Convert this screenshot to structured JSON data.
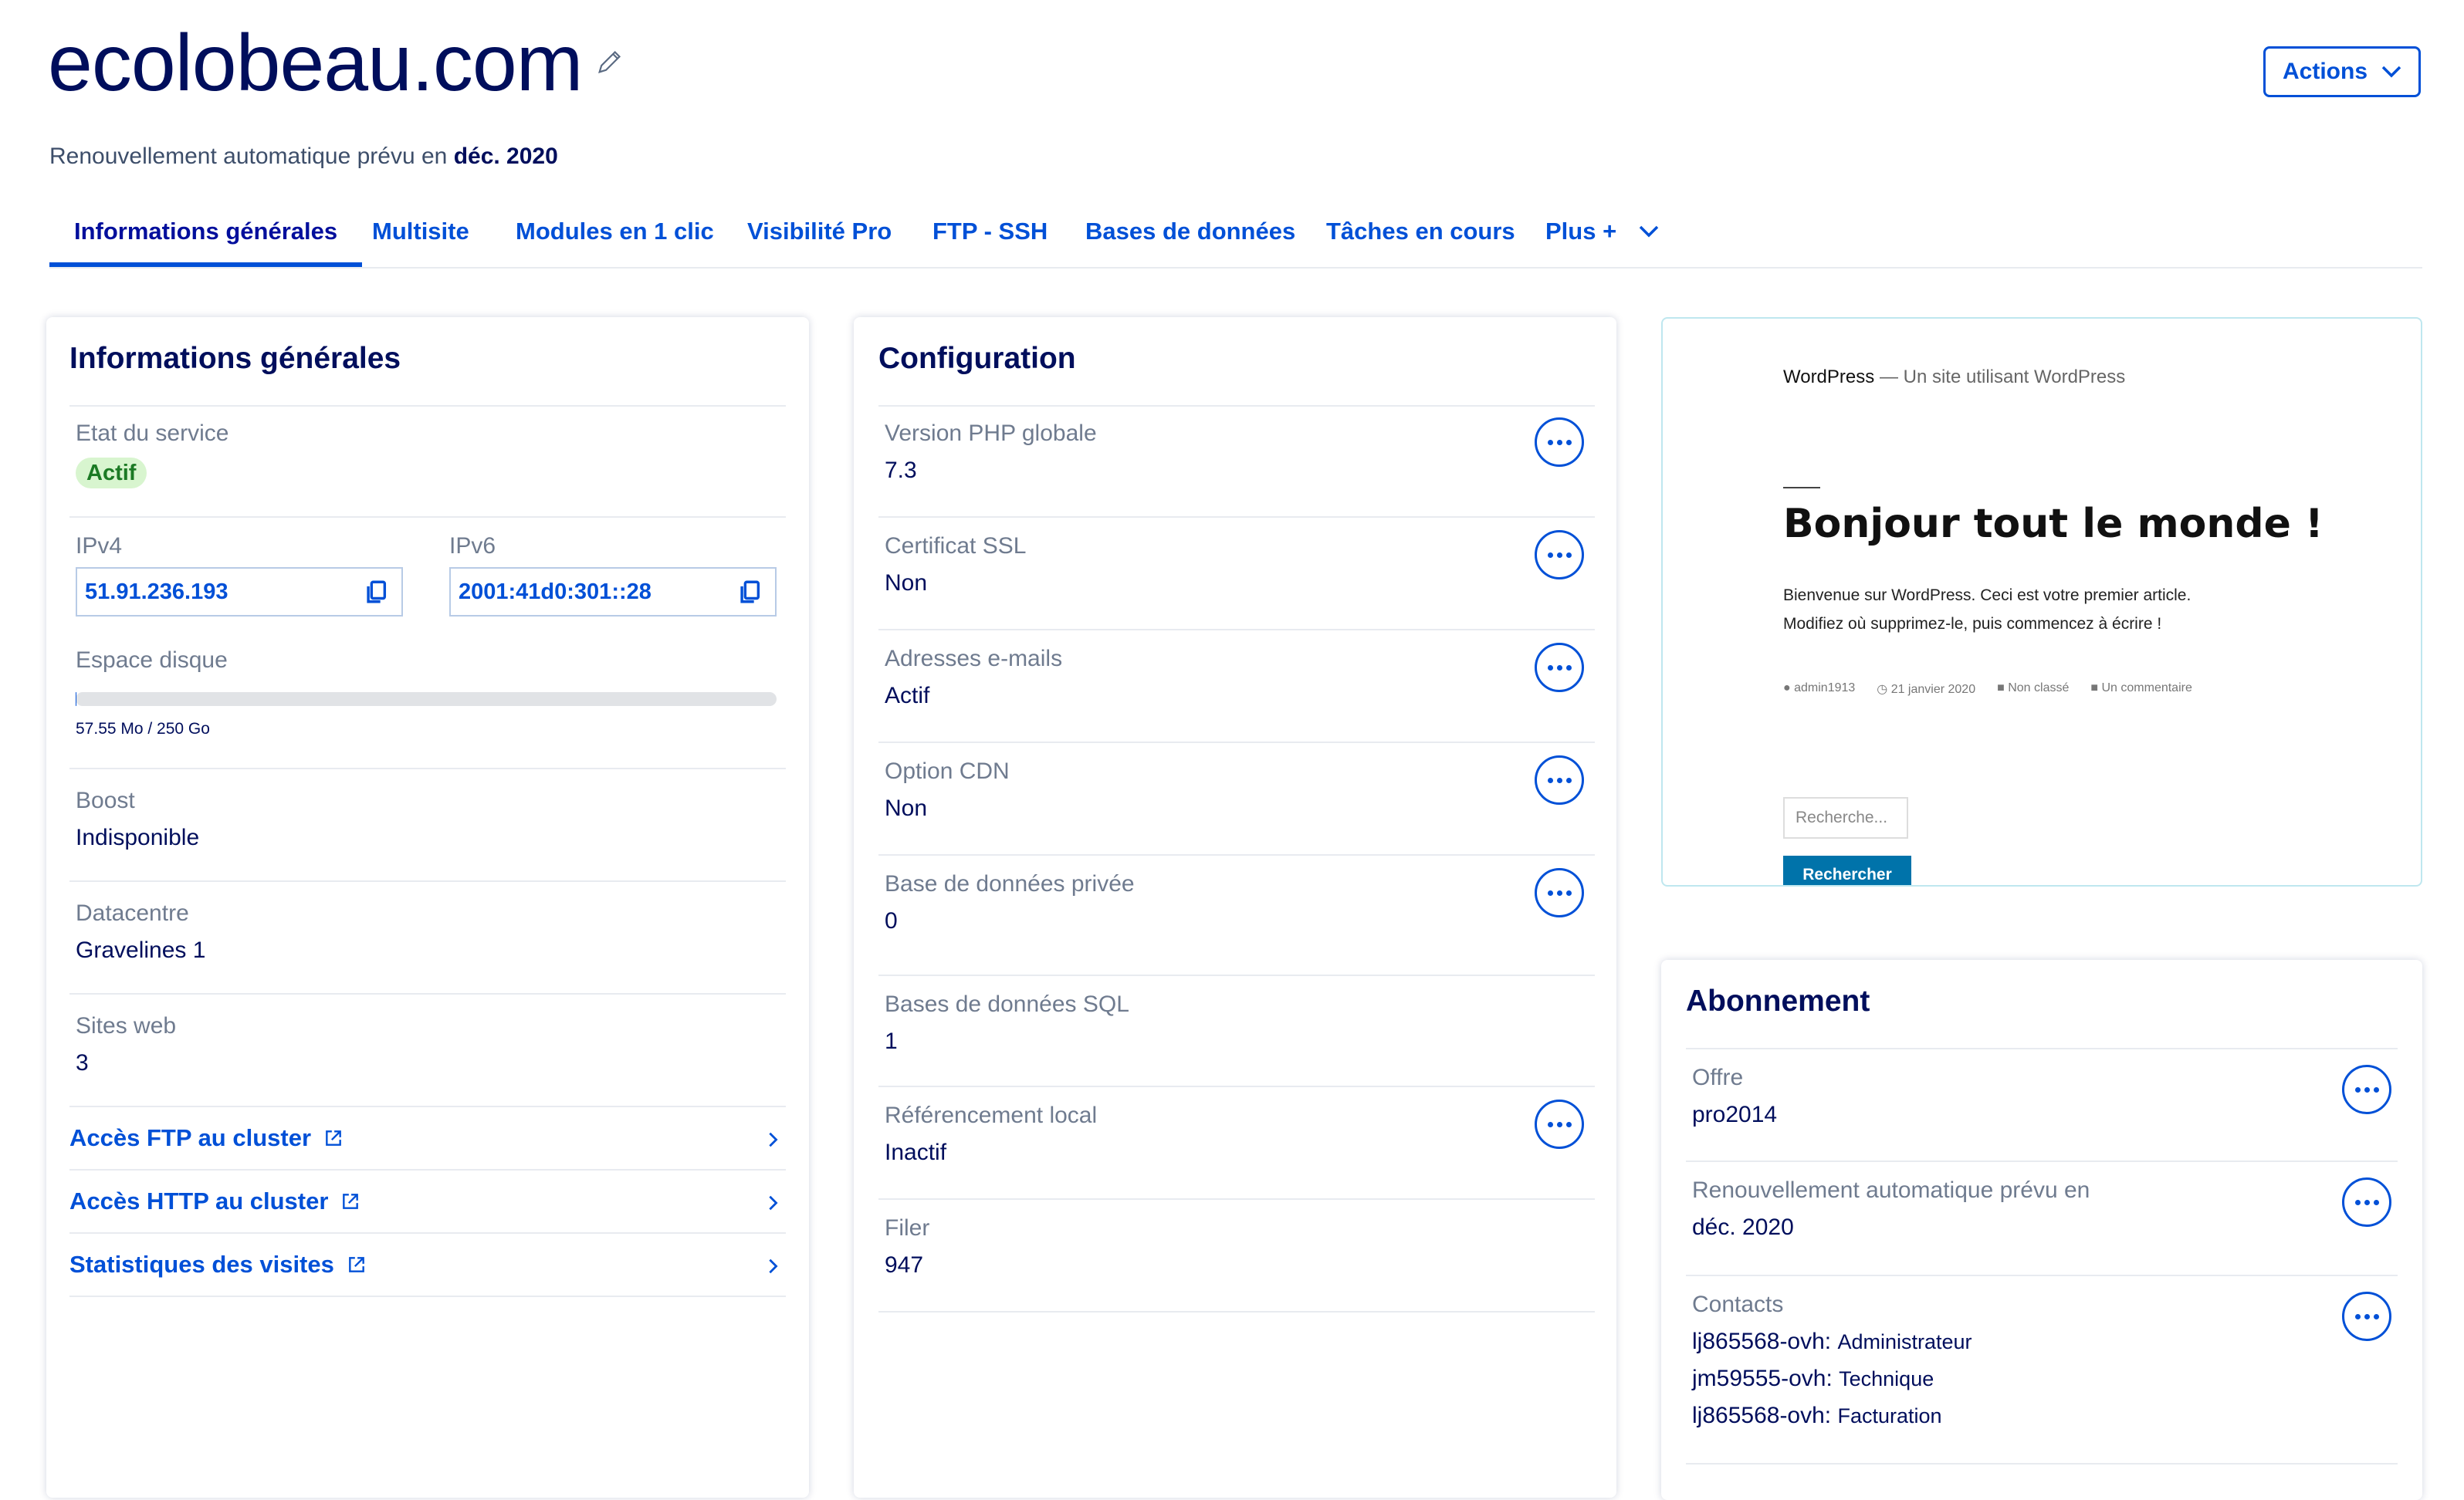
{
  "header": {
    "title": "ecolobeau.com",
    "renewal_prefix": "Renouvellement automatique prévu en",
    "renewal_date": "déc. 2020",
    "actions_label": "Actions"
  },
  "tabs": [
    {
      "label": "Informations générales",
      "active": true
    },
    {
      "label": "Multisite"
    },
    {
      "label": "Modules en 1 clic"
    },
    {
      "label": "Visibilité Pro"
    },
    {
      "label": "FTP - SSH"
    },
    {
      "label": "Bases de données"
    },
    {
      "label": "Tâches en cours"
    },
    {
      "label": "Plus +"
    }
  ],
  "general": {
    "title": "Informations générales",
    "service_state_label": "Etat du service",
    "service_state_value": "Actif",
    "ipv4_label": "IPv4",
    "ipv4_value": "51.91.236.193",
    "ipv6_label": "IPv6",
    "ipv6_value": "2001:41d0:301::28",
    "disk_label": "Espace disque",
    "disk_usage": "57.55 Mo / 250 Go",
    "disk_fraction": 0.0002,
    "boost_label": "Boost",
    "boost_value": "Indisponible",
    "datacenter_label": "Datacentre",
    "datacenter_value": "Gravelines 1",
    "websites_label": "Sites web",
    "websites_value": "3",
    "links": [
      "Accès FTP au cluster",
      "Accès HTTP au cluster",
      "Statistiques des visites"
    ]
  },
  "config": {
    "title": "Configuration",
    "rows": [
      {
        "label": "Version PHP globale",
        "value": "7.3"
      },
      {
        "label": "Certificat SSL",
        "value": "Non"
      },
      {
        "label": "Adresses e-mails",
        "value": "Actif"
      },
      {
        "label": "Option CDN",
        "value": "Non"
      },
      {
        "label": "Base de données privée",
        "value": "0"
      },
      {
        "label": "Bases de données SQL",
        "value": "1"
      },
      {
        "label": "Référencement local",
        "value": "Inactif"
      },
      {
        "label": "Filer",
        "value": "947"
      }
    ]
  },
  "preview": {
    "site_name": "WordPress",
    "tagline": "— Un site utilisant WordPress",
    "heading": "Bonjour tout le monde !",
    "para1": "Bienvenue sur WordPress. Ceci est votre premier article.",
    "para2": "Modifiez où supprimez-le, puis commencez à écrire !",
    "meta_author": "admin1913",
    "meta_date": "21 janvier 2020",
    "meta_category": "Non classé",
    "meta_comments": "Un commentaire",
    "search_placeholder": "Recherche...",
    "search_button": "Rechercher"
  },
  "subscription": {
    "title": "Abonnement",
    "offer_label": "Offre",
    "offer_value": "pro2014",
    "renewal_label": "Renouvellement automatique prévu en",
    "renewal_value": "déc. 2020",
    "contacts_label": "Contacts",
    "contacts": [
      {
        "id": "lj865568-ovh:",
        "role": "Administrateur"
      },
      {
        "id": "jm59555-ovh:",
        "role": "Technique"
      },
      {
        "id": "lj865568-ovh:",
        "role": "Facturation"
      }
    ]
  }
}
